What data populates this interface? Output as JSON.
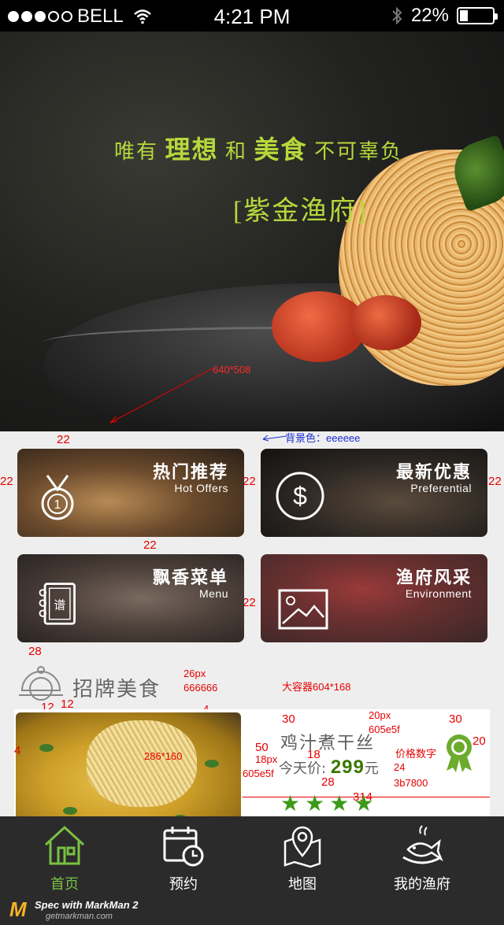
{
  "status_bar": {
    "carrier": "BELL",
    "time": "4:21 PM",
    "battery": "22%",
    "battery_level": 0.22
  },
  "hero": {
    "slogan": {
      "p1": "唯有 ",
      "w1": "理想",
      "p2": " 和 ",
      "w2": "美食",
      "p3": " 不可辜负"
    },
    "brand": "[紫金渔府]",
    "annotation": "640*508"
  },
  "annotations": {
    "background_color": "背景色：eeeeee",
    "gap_top": "22",
    "gap_left": "22",
    "gap_mid": "22",
    "gap_right": "22",
    "gap_row": "22",
    "gap_mid2": "22",
    "gap_section": "28",
    "section_font": "26px",
    "section_color": "666666",
    "icon_margin_left": "12",
    "icon_margin_right": "12",
    "container": "大容器604*168",
    "container_pad": "4",
    "image_size": "286*160",
    "card_left_pad": "4",
    "name_top": "30",
    "name_font": "20px",
    "name_color": "605e5f",
    "name_gap": "50",
    "price_font": "18px",
    "price_color": "605e5f",
    "price_line_gap": "18",
    "price_label": "价格数字",
    "price_num_font": "24",
    "price_num_color": "3b7800",
    "award_top": "30",
    "award_right": "20",
    "stars_top": "28",
    "text_width": "314"
  },
  "tiles": [
    {
      "title": "热门推荐",
      "subtitle": "Hot Offers",
      "icon": "medal-icon"
    },
    {
      "title": "最新优惠",
      "subtitle": "Preferential",
      "icon": "dollar-icon"
    },
    {
      "title": "飘香菜单",
      "subtitle": "Menu",
      "icon": "menu-book-icon",
      "icon_text": "谱"
    },
    {
      "title": "渔府风采",
      "subtitle": "Environment",
      "icon": "picture-icon"
    }
  ],
  "section": {
    "title": "招牌美食",
    "icon": "dish-cover-icon"
  },
  "dish": {
    "name": "鸡汁煮干丝",
    "price_label": "今天价:",
    "price": "299",
    "price_unit": "元",
    "rating": 4,
    "award_icon": "award-ribbon-icon"
  },
  "tabbar": [
    {
      "label": "首页",
      "icon": "home-icon",
      "active": true
    },
    {
      "label": "预约",
      "icon": "calendar-clock-icon",
      "active": false
    },
    {
      "label": "地图",
      "icon": "map-pin-icon",
      "active": false
    },
    {
      "label": "我的渔府",
      "icon": "fish-plate-icon",
      "active": false
    }
  ],
  "watermark": {
    "line1": "Spec with MarkMan 2",
    "line2": "getmarkman.com"
  },
  "colors": {
    "background": "#eeeeee",
    "accent_green": "#7ac143",
    "price_green": "#3b7800",
    "text_gray": "#605e5f",
    "section_gray": "#666666",
    "tabbar_bg": "#2b2b2b",
    "slogan_green": "#b7d83c"
  }
}
